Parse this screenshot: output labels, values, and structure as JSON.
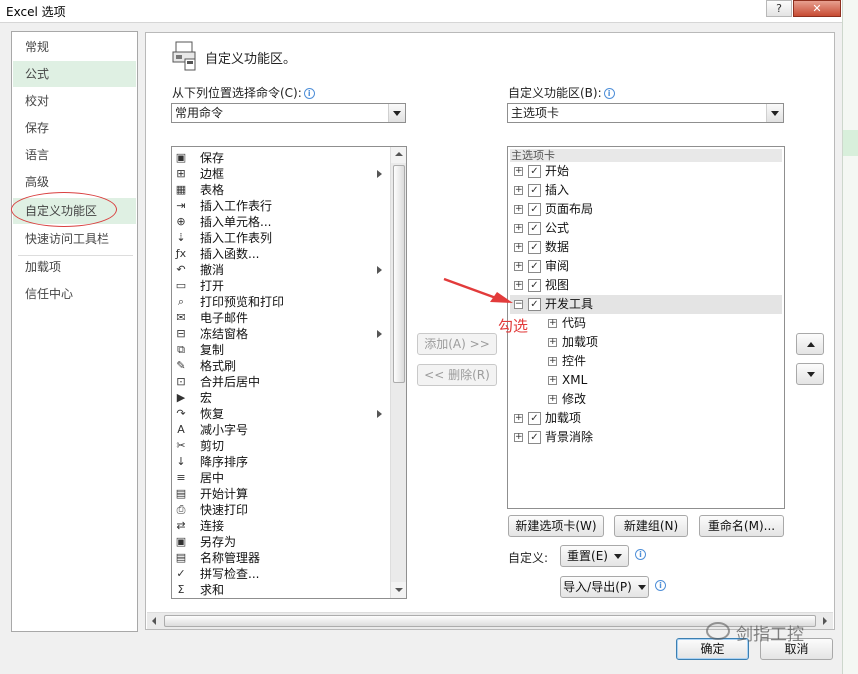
{
  "window": {
    "title": "Excel 选项",
    "help_glyph": "?",
    "close_glyph": "✕"
  },
  "nav": {
    "items": [
      "常规",
      "公式",
      "校对",
      "保存",
      "语言",
      "高级",
      "自定义功能区",
      "快速访问工具栏",
      "加载项",
      "信任中心"
    ],
    "selected": "自定义功能区"
  },
  "header": {
    "title": "自定义功能区。"
  },
  "left_panel": {
    "label": "从下列位置选择命令(C):",
    "dropdown_value": "常用命令",
    "commands": [
      {
        "label": "保存",
        "icon": "save-icon",
        "glyph": "▣",
        "submenu": false
      },
      {
        "label": "边框",
        "icon": "border-icon",
        "glyph": "⊞",
        "submenu": true
      },
      {
        "label": "表格",
        "icon": "table-icon",
        "glyph": "▦",
        "submenu": false
      },
      {
        "label": "插入工作表行",
        "icon": "insert-row-icon",
        "glyph": "⇥",
        "submenu": false
      },
      {
        "label": "插入单元格...",
        "icon": "insert-cell-icon",
        "glyph": "⊕",
        "submenu": false
      },
      {
        "label": "插入工作表列",
        "icon": "insert-column-icon",
        "glyph": "⇣",
        "submenu": false
      },
      {
        "label": "插入函数...",
        "icon": "function-icon",
        "glyph": "ƒx",
        "submenu": false
      },
      {
        "label": "撤消",
        "icon": "undo-icon",
        "glyph": "↶",
        "submenu": true
      },
      {
        "label": "打开",
        "icon": "open-folder-icon",
        "glyph": "▭",
        "submenu": false
      },
      {
        "label": "打印预览和打印",
        "icon": "print-preview-icon",
        "glyph": "⌕",
        "submenu": false
      },
      {
        "label": "电子邮件",
        "icon": "email-icon",
        "glyph": "✉",
        "submenu": false
      },
      {
        "label": "冻结窗格",
        "icon": "freeze-panes-icon",
        "glyph": "⊟",
        "submenu": true
      },
      {
        "label": "复制",
        "icon": "copy-icon",
        "glyph": "⧉",
        "submenu": false
      },
      {
        "label": "格式刷",
        "icon": "format-painter-icon",
        "glyph": "✎",
        "submenu": false
      },
      {
        "label": "合并后居中",
        "icon": "merge-center-icon",
        "glyph": "⊡",
        "submenu": false
      },
      {
        "label": "宏",
        "icon": "macro-icon",
        "glyph": "▶",
        "submenu": false
      },
      {
        "label": "恢复",
        "icon": "redo-icon",
        "glyph": "↷",
        "submenu": true
      },
      {
        "label": "减小字号",
        "icon": "decrease-font-icon",
        "glyph": "A",
        "submenu": false
      },
      {
        "label": "剪切",
        "icon": "cut-icon",
        "glyph": "✂",
        "submenu": false
      },
      {
        "label": "降序排序",
        "icon": "sort-descending-icon",
        "glyph": "↓",
        "submenu": false
      },
      {
        "label": "居中",
        "icon": "center-align-icon",
        "glyph": "≡",
        "submenu": false
      },
      {
        "label": "开始计算",
        "icon": "calculate-icon",
        "glyph": "▤",
        "submenu": false
      },
      {
        "label": "快速打印",
        "icon": "quick-print-icon",
        "glyph": "⎙",
        "submenu": false
      },
      {
        "label": "连接",
        "icon": "connections-icon",
        "glyph": "⇄",
        "submenu": false
      },
      {
        "label": "另存为",
        "icon": "save-as-icon",
        "glyph": "▣",
        "submenu": false
      },
      {
        "label": "名称管理器",
        "icon": "name-manager-icon",
        "glyph": "▤",
        "submenu": false
      },
      {
        "label": "拼写检查...",
        "icon": "spell-check-icon",
        "glyph": "✓",
        "submenu": false
      },
      {
        "label": "求和",
        "icon": "sum-icon",
        "glyph": "Σ",
        "submenu": false
      }
    ]
  },
  "middle_buttons": {
    "add": "添加(A) >>",
    "remove": "<< 删除(R)"
  },
  "right_panel": {
    "label": "自定义功能区(B):",
    "dropdown_value": "主选项卡",
    "tree_header": "主选项卡",
    "tree": [
      {
        "label": "开始",
        "level": 0,
        "expander": "+",
        "checked": true
      },
      {
        "label": "插入",
        "level": 0,
        "expander": "+",
        "checked": true
      },
      {
        "label": "页面布局",
        "level": 0,
        "expander": "+",
        "checked": true
      },
      {
        "label": "公式",
        "level": 0,
        "expander": "+",
        "checked": true
      },
      {
        "label": "数据",
        "level": 0,
        "expander": "+",
        "checked": true
      },
      {
        "label": "审阅",
        "level": 0,
        "expander": "+",
        "checked": true
      },
      {
        "label": "视图",
        "level": 0,
        "expander": "+",
        "checked": true
      },
      {
        "label": "开发工具",
        "level": 0,
        "expander": "−",
        "checked": true,
        "highlighted": true
      },
      {
        "label": "代码",
        "level": 1,
        "expander": "+"
      },
      {
        "label": "加载项",
        "level": 1,
        "expander": "+"
      },
      {
        "label": "控件",
        "level": 1,
        "expander": "+"
      },
      {
        "label": "XML",
        "level": 1,
        "expander": "+"
      },
      {
        "label": "修改",
        "level": 1,
        "expander": "+"
      },
      {
        "label": "加载项",
        "level": 0,
        "expander": "+",
        "checked": true
      },
      {
        "label": "背景消除",
        "level": 0,
        "expander": "+",
        "checked": true
      }
    ],
    "new_tab": "新建选项卡(W)",
    "new_group": "新建组(N)",
    "rename": "重命名(M)...",
    "customize_label": "自定义:",
    "reset": "重置(E)",
    "import_export": "导入/导出(P)"
  },
  "footer": {
    "ok": "确定",
    "cancel": "取消"
  },
  "annotation": {
    "text": "勾选",
    "color": "#e23b3b"
  },
  "watermark": {
    "text": "剑指工控"
  }
}
